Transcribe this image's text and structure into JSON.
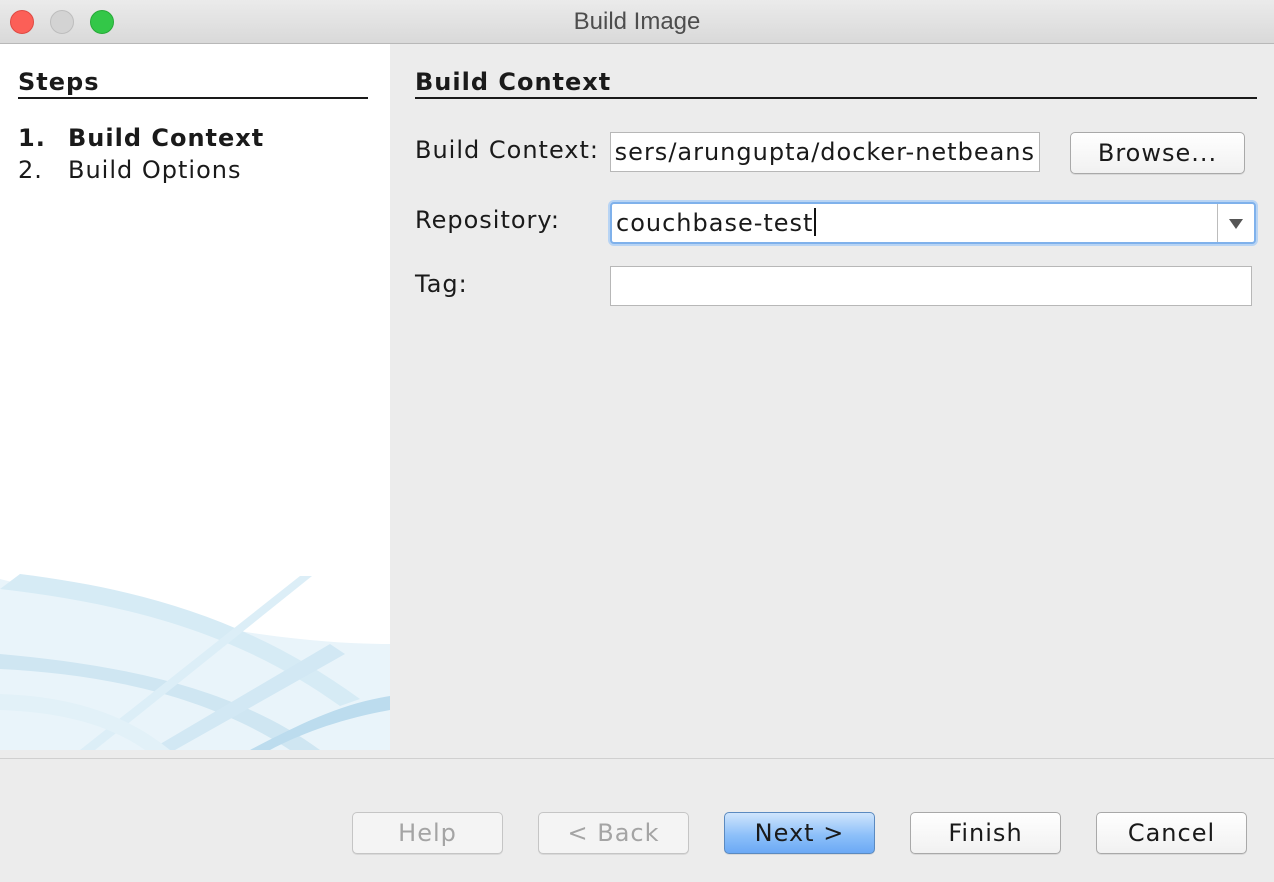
{
  "window": {
    "title": "Build Image"
  },
  "steps": {
    "heading": "Steps",
    "items": [
      {
        "number": "1.",
        "label": "Build Context",
        "active": true
      },
      {
        "number": "2.",
        "label": "Build Options",
        "active": false
      }
    ]
  },
  "panel": {
    "heading": "Build Context",
    "build_context": {
      "label": "Build Context:",
      "value": "sers/arungupta/docker-netbeans",
      "browse_label": "Browse..."
    },
    "repository": {
      "label": "Repository:",
      "value": "couchbase-test"
    },
    "tag": {
      "label": "Tag:",
      "value": ""
    }
  },
  "footer": {
    "help": "Help",
    "back": "< Back",
    "next": "Next >",
    "finish": "Finish",
    "cancel": "Cancel"
  }
}
